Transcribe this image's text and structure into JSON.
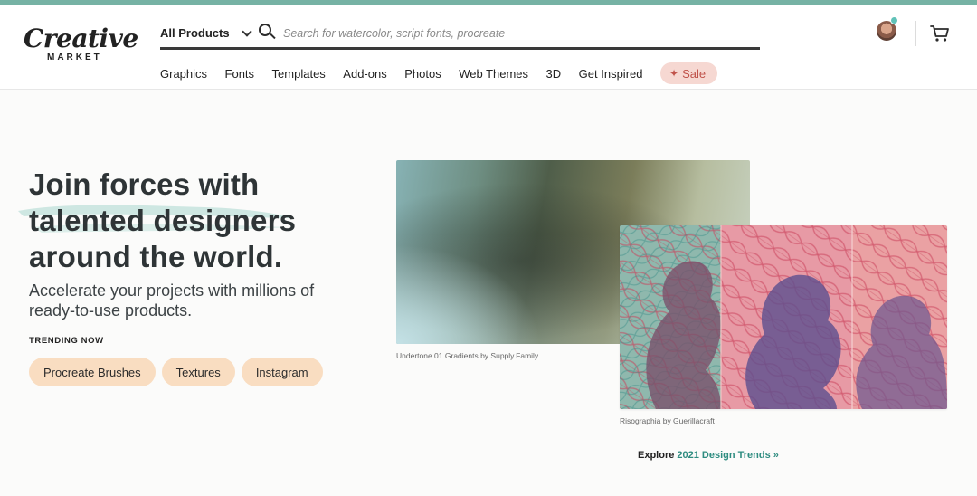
{
  "header": {
    "logo": {
      "wordmark": "Creative",
      "sub": "MARKET"
    },
    "category_select": {
      "value": "All Products"
    },
    "search": {
      "placeholder": "Search for watercolor, script fonts, procreate",
      "value": ""
    },
    "nav": [
      {
        "label": "Graphics"
      },
      {
        "label": "Fonts"
      },
      {
        "label": "Templates"
      },
      {
        "label": "Add-ons"
      },
      {
        "label": "Photos"
      },
      {
        "label": "Web Themes"
      },
      {
        "label": "3D"
      },
      {
        "label": "Get Inspired"
      }
    ],
    "sale": {
      "label": "Sale",
      "icon": "sparkle-icon"
    },
    "icons": {
      "avatar": "user-avatar",
      "cart": "cart-icon"
    }
  },
  "hero": {
    "title_lines": [
      "Join forces with",
      "talented designers",
      "around the world."
    ],
    "subtitle": "Accelerate your projects with millions of ready-to-use products.",
    "trending_label": "TRENDING NOW",
    "trending": [
      {
        "label": "Procreate Brushes"
      },
      {
        "label": "Textures"
      },
      {
        "label": "Instagram"
      }
    ]
  },
  "gallery": {
    "image1_caption": "Undertone 01 Gradients by Supply.Family",
    "image2_caption": "Risographia by Guerillacraft",
    "explore_prefix": "Explore ",
    "explore_link": "2021 Design Trends »"
  },
  "colors": {
    "accent_bar": "#76b2a4",
    "sale_bg": "#f6d8d2",
    "sale_text": "#c0524a",
    "chip_bg": "#f9ddc1",
    "link": "#2e8c80",
    "notification_dot": "#60c2b8"
  }
}
